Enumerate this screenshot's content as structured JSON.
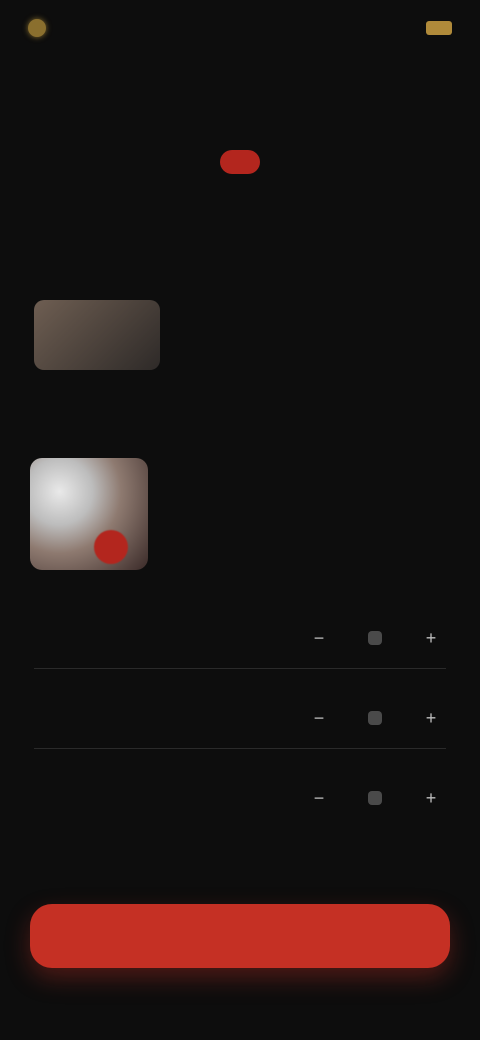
{
  "status": {
    "time": "",
    "right": ""
  },
  "title": "",
  "tabs": [
    {
      "label": ""
    },
    {
      "label": ""
    },
    {
      "label": ""
    }
  ],
  "labels": {
    "section": ""
  },
  "movie": {
    "title": "",
    "subtitle": ""
  },
  "pick": {
    "header": "",
    "text": ""
  },
  "rows": [
    {
      "label": ""
    },
    {
      "label": ""
    },
    {
      "label": ""
    }
  ],
  "note": "",
  "cta": "",
  "bottom": ""
}
